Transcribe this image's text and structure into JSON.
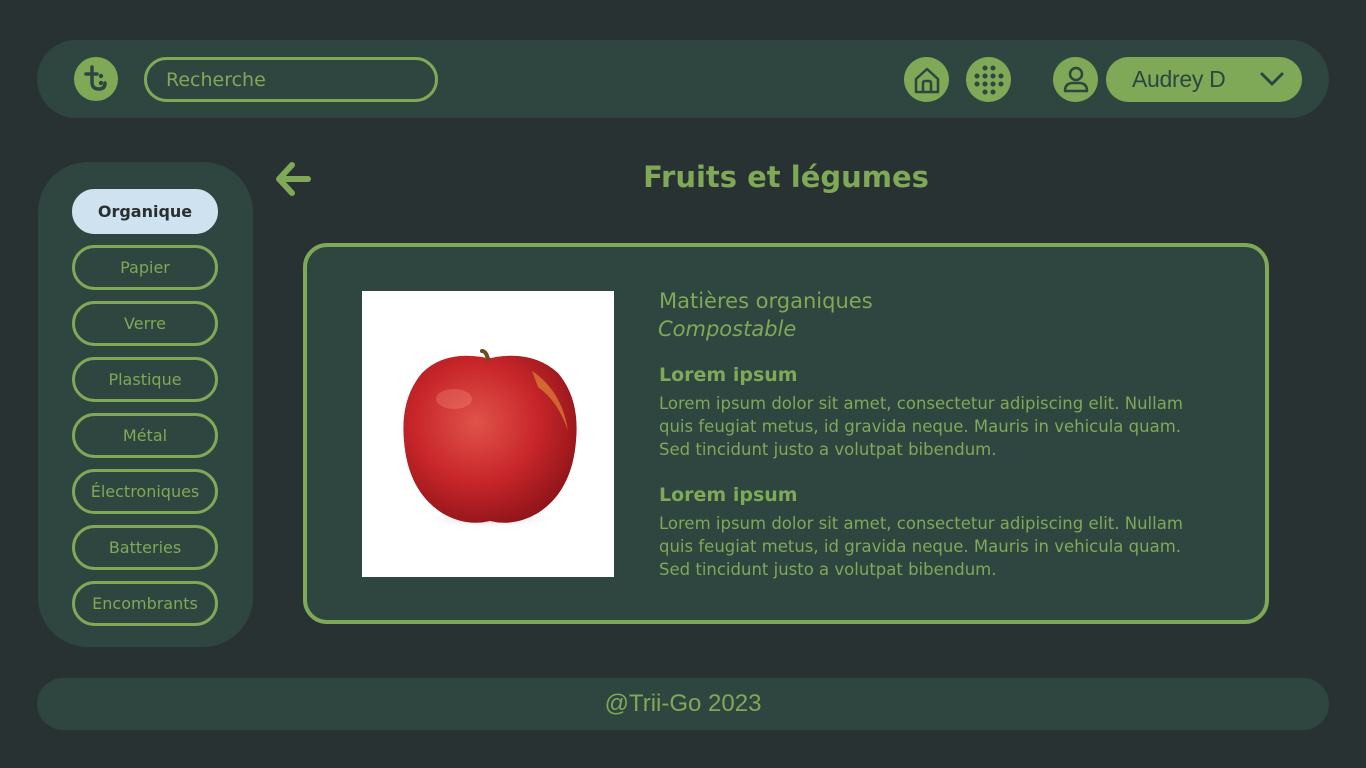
{
  "header": {
    "logo_icon": "trii-go-logo-icon",
    "search": {
      "placeholder": "Recherche",
      "value": ""
    },
    "home_icon": "home-icon",
    "apps_icon": "grid-dots-icon",
    "user_icon": "user-icon",
    "user_name": "Audrey D",
    "user_menu_icon": "chevron-down-icon"
  },
  "sidebar": {
    "items": [
      {
        "label": "Organique",
        "active": true
      },
      {
        "label": "Papier",
        "active": false
      },
      {
        "label": "Verre",
        "active": false
      },
      {
        "label": "Plastique",
        "active": false
      },
      {
        "label": "Métal",
        "active": false
      },
      {
        "label": "Électroniques",
        "active": false
      },
      {
        "label": "Batteries",
        "active": false
      },
      {
        "label": "Encombrants",
        "active": false
      }
    ]
  },
  "main": {
    "back_icon": "arrow-left-icon",
    "title": "Fruits et légumes",
    "card": {
      "material": "Matières organiques",
      "disposal": "Compostable",
      "sections": [
        {
          "title": "Lorem ipsum",
          "body": "Lorem ipsum dolor sit amet, consectetur adipiscing elit. Nullam quis feugiat metus, id gravida neque. Mauris in vehicula quam. Sed tincidunt justo a volutpat bibendum."
        },
        {
          "title": "Lorem ipsum",
          "body": "Lorem ipsum dolor sit amet, consectetur adipiscing elit. Nullam quis feugiat metus, id gravida neque. Mauris in vehicula quam. Sed tincidunt justo a volutpat bibendum."
        }
      ]
    }
  },
  "footer": {
    "text": "@Trii-Go 2023"
  },
  "colors": {
    "background": "#283233",
    "panel": "#2f4640",
    "accent": "#7fa857",
    "active_tab": "#cfe2ef"
  }
}
